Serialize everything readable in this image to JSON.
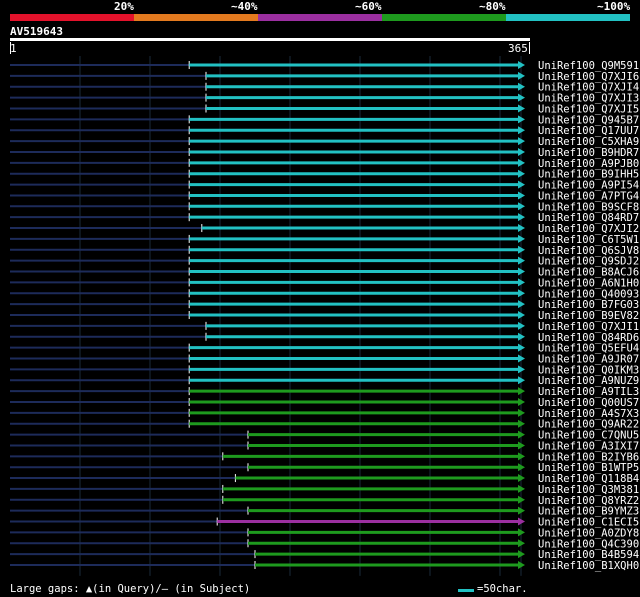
{
  "legend": {
    "segments": [
      {
        "label": "20%",
        "color": "#e3122b"
      },
      {
        "label": "~40%",
        "color": "#e37a1f"
      },
      {
        "label": "~60%",
        "color": "#9b2fa0"
      },
      {
        "label": "~80%",
        "color": "#1e9a1e"
      },
      {
        "label": "~100%",
        "color": "#22c1c3"
      }
    ]
  },
  "query": {
    "name": "AV519643",
    "start": "1",
    "end": "365"
  },
  "footer": {
    "gaps_note": "Large gaps: ▲(in Query)/— (in Subject)",
    "scale_note": "=50char."
  },
  "chart_data": {
    "type": "alignment",
    "query_length": 365,
    "grid_step": 50,
    "hits": [
      {
        "id": "UniRef100_Q9M591",
        "start": 128,
        "identity": "~100%",
        "color": "#22c1c3"
      },
      {
        "id": "UniRef100_Q7XJI6",
        "start": 140,
        "identity": "~100%",
        "color": "#22c1c3"
      },
      {
        "id": "UniRef100_Q7XJI4",
        "start": 140,
        "identity": "~100%",
        "color": "#22c1c3"
      },
      {
        "id": "UniRef100_Q7XJI3",
        "start": 140,
        "identity": "~100%",
        "color": "#22c1c3"
      },
      {
        "id": "UniRef100_Q7XJI5",
        "start": 140,
        "identity": "~100%",
        "color": "#22c1c3"
      },
      {
        "id": "UniRef100_Q945B7",
        "start": 128,
        "identity": "~100%",
        "color": "#22c1c3"
      },
      {
        "id": "UniRef100_Q17UU7",
        "start": 128,
        "identity": "~100%",
        "color": "#22c1c3"
      },
      {
        "id": "UniRef100_C5XHA9",
        "start": 128,
        "identity": "~100%",
        "color": "#22c1c3"
      },
      {
        "id": "UniRef100_B9HDR7",
        "start": 128,
        "identity": "~100%",
        "color": "#22c1c3"
      },
      {
        "id": "UniRef100_A9PJB0",
        "start": 128,
        "identity": "~100%",
        "color": "#22c1c3"
      },
      {
        "id": "UniRef100_B9IHH5",
        "start": 128,
        "identity": "~100%",
        "color": "#22c1c3"
      },
      {
        "id": "UniRef100_A9PI54",
        "start": 128,
        "identity": "~100%",
        "color": "#22c1c3"
      },
      {
        "id": "UniRef100_A7PTG4",
        "start": 128,
        "identity": "~100%",
        "color": "#22c1c3"
      },
      {
        "id": "UniRef100_B9SCF8",
        "start": 128,
        "identity": "~100%",
        "color": "#22c1c3"
      },
      {
        "id": "UniRef100_Q84RD7",
        "start": 128,
        "identity": "~100%",
        "color": "#22c1c3"
      },
      {
        "id": "UniRef100_Q7XJI2",
        "start": 137,
        "identity": "~100%",
        "color": "#22c1c3"
      },
      {
        "id": "UniRef100_C6T5W1",
        "start": 128,
        "identity": "~100%",
        "color": "#22c1c3"
      },
      {
        "id": "UniRef100_Q6SJV8",
        "start": 128,
        "identity": "~100%",
        "color": "#22c1c3"
      },
      {
        "id": "UniRef100_Q9SDJ2",
        "start": 128,
        "identity": "~100%",
        "color": "#22c1c3"
      },
      {
        "id": "UniRef100_B8ACJ6",
        "start": 128,
        "identity": "~100%",
        "color": "#22c1c3"
      },
      {
        "id": "UniRef100_A6N1H0",
        "start": 128,
        "identity": "~100%",
        "color": "#22c1c3"
      },
      {
        "id": "UniRef100_Q40093",
        "start": 128,
        "identity": "~100%",
        "color": "#22c1c3"
      },
      {
        "id": "UniRef100_B7FG03",
        "start": 128,
        "identity": "~100%",
        "color": "#22c1c3"
      },
      {
        "id": "UniRef100_B9EV82",
        "start": 128,
        "identity": "~100%",
        "color": "#22c1c3"
      },
      {
        "id": "UniRef100_Q7XJI1",
        "start": 140,
        "identity": "~100%",
        "color": "#22c1c3"
      },
      {
        "id": "UniRef100_Q84RD6",
        "start": 140,
        "identity": "~100%",
        "color": "#22c1c3"
      },
      {
        "id": "UniRef100_Q5EFU4",
        "start": 128,
        "identity": "~100%",
        "color": "#22c1c3"
      },
      {
        "id": "UniRef100_A9JR07",
        "start": 128,
        "identity": "~100%",
        "color": "#22c1c3"
      },
      {
        "id": "UniRef100_Q0IKM3",
        "start": 128,
        "identity": "~100%",
        "color": "#22c1c3"
      },
      {
        "id": "UniRef100_A9NUZ9",
        "start": 128,
        "identity": "~100%",
        "color": "#22c1c3"
      },
      {
        "id": "UniRef100_A9TIL3",
        "start": 128,
        "identity": "~80%",
        "color": "#1e9a1e"
      },
      {
        "id": "UniRef100_Q00US7",
        "start": 128,
        "identity": "~80%",
        "color": "#1e9a1e"
      },
      {
        "id": "UniRef100_A4S7X3",
        "start": 128,
        "identity": "~80%",
        "color": "#1e9a1e"
      },
      {
        "id": "UniRef100_Q9AR22",
        "start": 128,
        "identity": "~80%",
        "color": "#1e9a1e"
      },
      {
        "id": "UniRef100_C7QNU5",
        "start": 170,
        "identity": "~80%",
        "color": "#1e9a1e"
      },
      {
        "id": "UniRef100_A3IXI7",
        "start": 170,
        "identity": "~80%",
        "color": "#1e9a1e"
      },
      {
        "id": "UniRef100_B2IYB6",
        "start": 152,
        "identity": "~80%",
        "color": "#1e9a1e"
      },
      {
        "id": "UniRef100_B1WTP5",
        "start": 170,
        "identity": "~80%",
        "color": "#1e9a1e"
      },
      {
        "id": "UniRef100_Q118B4",
        "start": 161,
        "identity": "~80%",
        "color": "#1e9a1e"
      },
      {
        "id": "UniRef100_Q3M381",
        "start": 152,
        "identity": "~80%",
        "color": "#1e9a1e"
      },
      {
        "id": "UniRef100_Q8YRZ2",
        "start": 152,
        "identity": "~80%",
        "color": "#1e9a1e"
      },
      {
        "id": "UniRef100_B9YMZ3",
        "start": 170,
        "identity": "~80%",
        "color": "#1e9a1e"
      },
      {
        "id": "UniRef100_C1ECI5",
        "start": 148,
        "identity": "~60%",
        "color": "#9b2fa0"
      },
      {
        "id": "UniRef100_A0ZDY8",
        "start": 170,
        "identity": "~80%",
        "color": "#1e9a1e"
      },
      {
        "id": "UniRef100_Q4C390",
        "start": 170,
        "identity": "~80%",
        "color": "#1e9a1e"
      },
      {
        "id": "UniRef100_B4B594",
        "start": 175,
        "identity": "~80%",
        "color": "#1e9a1e"
      },
      {
        "id": "UniRef100_B1XQH0",
        "start": 175,
        "identity": "~80%",
        "color": "#1e9a1e"
      }
    ]
  }
}
